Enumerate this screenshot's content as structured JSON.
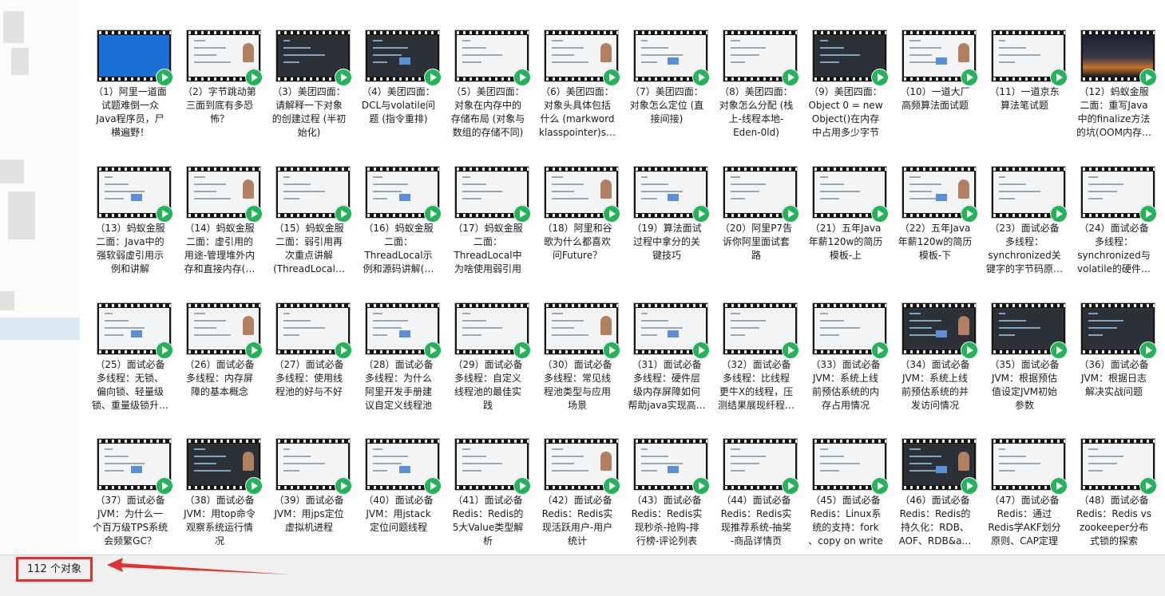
{
  "status": {
    "object_count": "112 个对象"
  },
  "colors": {
    "annotation": "#e2302b",
    "play_icon": "#25b35a"
  },
  "items": [
    {
      "label": "（1）阿里一道面\n试题难倒一众\nJava程序员，尸\n横遍野！",
      "thumb": "blue",
      "icon": "video-thumbnail-icon"
    },
    {
      "label": "（2）字节跳动第\n三面到底有多恐\n怖？",
      "thumb": "light",
      "icon": "video-thumbnail-icon"
    },
    {
      "label": "（3）美团四面：\n请解释一下对象\n的创建过程 (半初\n始化)",
      "thumb": "dark",
      "icon": "video-thumbnail-icon"
    },
    {
      "label": "（4）美团四面：\nDCL与volatile问\n题 (指令重排)",
      "thumb": "dark",
      "icon": "video-thumbnail-icon"
    },
    {
      "label": "（5）美团四面：\n对象在内存中的\n存储布局 (对象与\n数组的存储不同)",
      "thumb": "light",
      "icon": "video-thumbnail-icon"
    },
    {
      "label": "（6）美团四面：\n对象头具体包括\n什么 (markword\nklasspointer)s…",
      "thumb": "light",
      "icon": "video-thumbnail-icon"
    },
    {
      "label": "（7）美团四面：\n对象怎么定位 (直\n接间接)",
      "thumb": "light",
      "icon": "video-thumbnail-icon"
    },
    {
      "label": "（8）美团四面：\n对象怎么分配 (栈\n上-线程本地-\nEden-0ld)",
      "thumb": "light",
      "icon": "video-thumbnail-icon"
    },
    {
      "label": "（9）美团四面：\nObject 0 = new\nObject()在内存\n中占用多少字节",
      "thumb": "dark",
      "icon": "video-thumbnail-icon"
    },
    {
      "label": "（10）一道大厂\n高频算法面试题",
      "thumb": "light",
      "icon": "video-thumbnail-icon"
    },
    {
      "label": "（11）一道京东\n算法笔试题",
      "thumb": "light",
      "icon": "video-thumbnail-icon"
    },
    {
      "label": "（12）蚂蚁金服\n二面：重写Java\n中的finalize方法\n的坑(OOM内存…",
      "thumb": "night",
      "icon": "video-thumbnail-icon"
    },
    {
      "label": "（13）蚂蚁金服\n二面：Java中的\n强软弱虚引用示\n例和讲解",
      "thumb": "light",
      "icon": "video-thumbnail-icon"
    },
    {
      "label": "（14）蚂蚁金服\n二面：虚引用的\n用途-管理堆外内\n存和直接内存(…",
      "thumb": "light",
      "icon": "video-thumbnail-icon"
    },
    {
      "label": "（15）蚂蚁金服\n二面：弱引用再\n次重点讲解\n(ThreadLocal…",
      "thumb": "light",
      "icon": "video-thumbnail-icon"
    },
    {
      "label": "（16）蚂蚁金服\n二面：\nThreadLocal示\n例和源码讲解(…",
      "thumb": "light",
      "icon": "video-thumbnail-icon"
    },
    {
      "label": "（17）蚂蚁金服\n二面：\nThreadLocal中\n为啥使用弱引用",
      "thumb": "light",
      "icon": "video-thumbnail-icon"
    },
    {
      "label": "（18）阿里和谷\n歌为什么都喜欢\n问Future？",
      "thumb": "light",
      "icon": "video-thumbnail-icon"
    },
    {
      "label": "（19）算法面试\n过程中拿分的关\n键技巧",
      "thumb": "light",
      "icon": "video-thumbnail-icon"
    },
    {
      "label": "（20）阿里P7告\n诉你阿里面试套\n路",
      "thumb": "light",
      "icon": "video-thumbnail-icon"
    },
    {
      "label": "（21）五年Java\n年薪120w的简历\n模板-上",
      "thumb": "light",
      "icon": "video-thumbnail-icon"
    },
    {
      "label": "（22）五年Java\n年薪120w的简历\n模板-下",
      "thumb": "light",
      "icon": "video-thumbnail-icon"
    },
    {
      "label": "（23）面试必备\n多线程：\nsynchronized关\n键字的字节码原…",
      "thumb": "light",
      "icon": "video-thumbnail-icon"
    },
    {
      "label": "（24）面试必备\n多线程：\nsynchronized与\nvolatile的硬件…",
      "thumb": "light",
      "icon": "video-thumbnail-icon"
    },
    {
      "label": "（25）面试必备\n多线程：无锁、\n偏向锁、轻量级\n锁、重量级锁升…",
      "thumb": "light",
      "icon": "video-thumbnail-icon"
    },
    {
      "label": "（26）面试必备\n多线程：内存屏\n障的基本概念",
      "thumb": "light",
      "icon": "video-thumbnail-icon"
    },
    {
      "label": "（27）面试必备\n多线程：使用线\n程池的好与不好",
      "thumb": "light",
      "icon": "video-thumbnail-icon"
    },
    {
      "label": "（28）面试必备\n多线程：为什么\n阿里开发手册建\n议自定义线程池",
      "thumb": "light",
      "icon": "video-thumbnail-icon"
    },
    {
      "label": "（29）面试必备\n多线程：自定义\n线程池的最佳实\n践",
      "thumb": "light",
      "icon": "video-thumbnail-icon"
    },
    {
      "label": "（30）面试必备\n多线程：常见线\n程池类型与应用\n场景",
      "thumb": "light",
      "icon": "video-thumbnail-icon"
    },
    {
      "label": "（31）面试必备\n多线程：硬件层\n级内存屏障如何\n帮助java实现高…",
      "thumb": "light",
      "icon": "video-thumbnail-icon"
    },
    {
      "label": "（32）面试必备\n多线程：比线程\n更牛X的线程，压\n测结果展现纤程…",
      "thumb": "light",
      "icon": "video-thumbnail-icon"
    },
    {
      "label": "（33）面试必备\nJVM：系统上线\n前预估系统的内\n存占用情况",
      "thumb": "light",
      "icon": "video-thumbnail-icon"
    },
    {
      "label": "（34）面试必备\nJVM：系统上线\n前预估系统的并\n发访问情况",
      "thumb": "dark",
      "icon": "video-thumbnail-icon"
    },
    {
      "label": "（35）面试必备\nJVM：根据预估\n值设定JVM初始\n参数",
      "thumb": "dark",
      "icon": "video-thumbnail-icon"
    },
    {
      "label": "（36）面试必备\nJVM：根据日志\n解决实战问题",
      "thumb": "dark",
      "icon": "video-thumbnail-icon"
    },
    {
      "label": "（37）面试必备\nJVM：为什么一\n个百万级TPS系统\n会频繁GC？",
      "thumb": "light",
      "icon": "video-thumbnail-icon"
    },
    {
      "label": "（38）面试必备\nJVM：用top命令\n观察系统运行情\n况",
      "thumb": "dark",
      "icon": "video-thumbnail-icon"
    },
    {
      "label": "（39）面试必备\nJVM：用jps定位\n虚拟机进程",
      "thumb": "light",
      "icon": "video-thumbnail-icon"
    },
    {
      "label": "（40）面试必备\nJVM：用jstack\n定位问题线程",
      "thumb": "light",
      "icon": "video-thumbnail-icon"
    },
    {
      "label": "（41）面试必备\nRedis：Redis的\n5大Value类型解\n析",
      "thumb": "light",
      "icon": "video-thumbnail-icon"
    },
    {
      "label": "（42）面试必备\nRedis：Redis实\n现活跃用户-用户\n统计",
      "thumb": "light",
      "icon": "video-thumbnail-icon"
    },
    {
      "label": "（43）面试必备\nRedis：Redis实\n现秒杀-抢购-排\n行榜-评论列表",
      "thumb": "light",
      "icon": "video-thumbnail-icon"
    },
    {
      "label": "（44）面试必备\nRedis：Redis实\n现推荐系统-抽奖\n-商品详情页",
      "thumb": "light",
      "icon": "video-thumbnail-icon"
    },
    {
      "label": "（45）面试必备\nRedis：Linux系\n统的支持：fork\n、copy on write",
      "thumb": "light",
      "icon": "video-thumbnail-icon"
    },
    {
      "label": "（46）面试必备\nRedis：Redis的\n持久化：RDB、\nAOF、RDB&a…",
      "thumb": "dark",
      "icon": "video-thumbnail-icon"
    },
    {
      "label": "（47）面试必备\nRedis：通过\nRedis学AKF划分\n原则、CAP定理",
      "thumb": "light",
      "icon": "video-thumbnail-icon"
    },
    {
      "label": "（48）面试必备\nRedis：Redis vs\nzookeeper分布\n式锁的探索",
      "thumb": "light",
      "icon": "video-thumbnail-icon"
    }
  ]
}
